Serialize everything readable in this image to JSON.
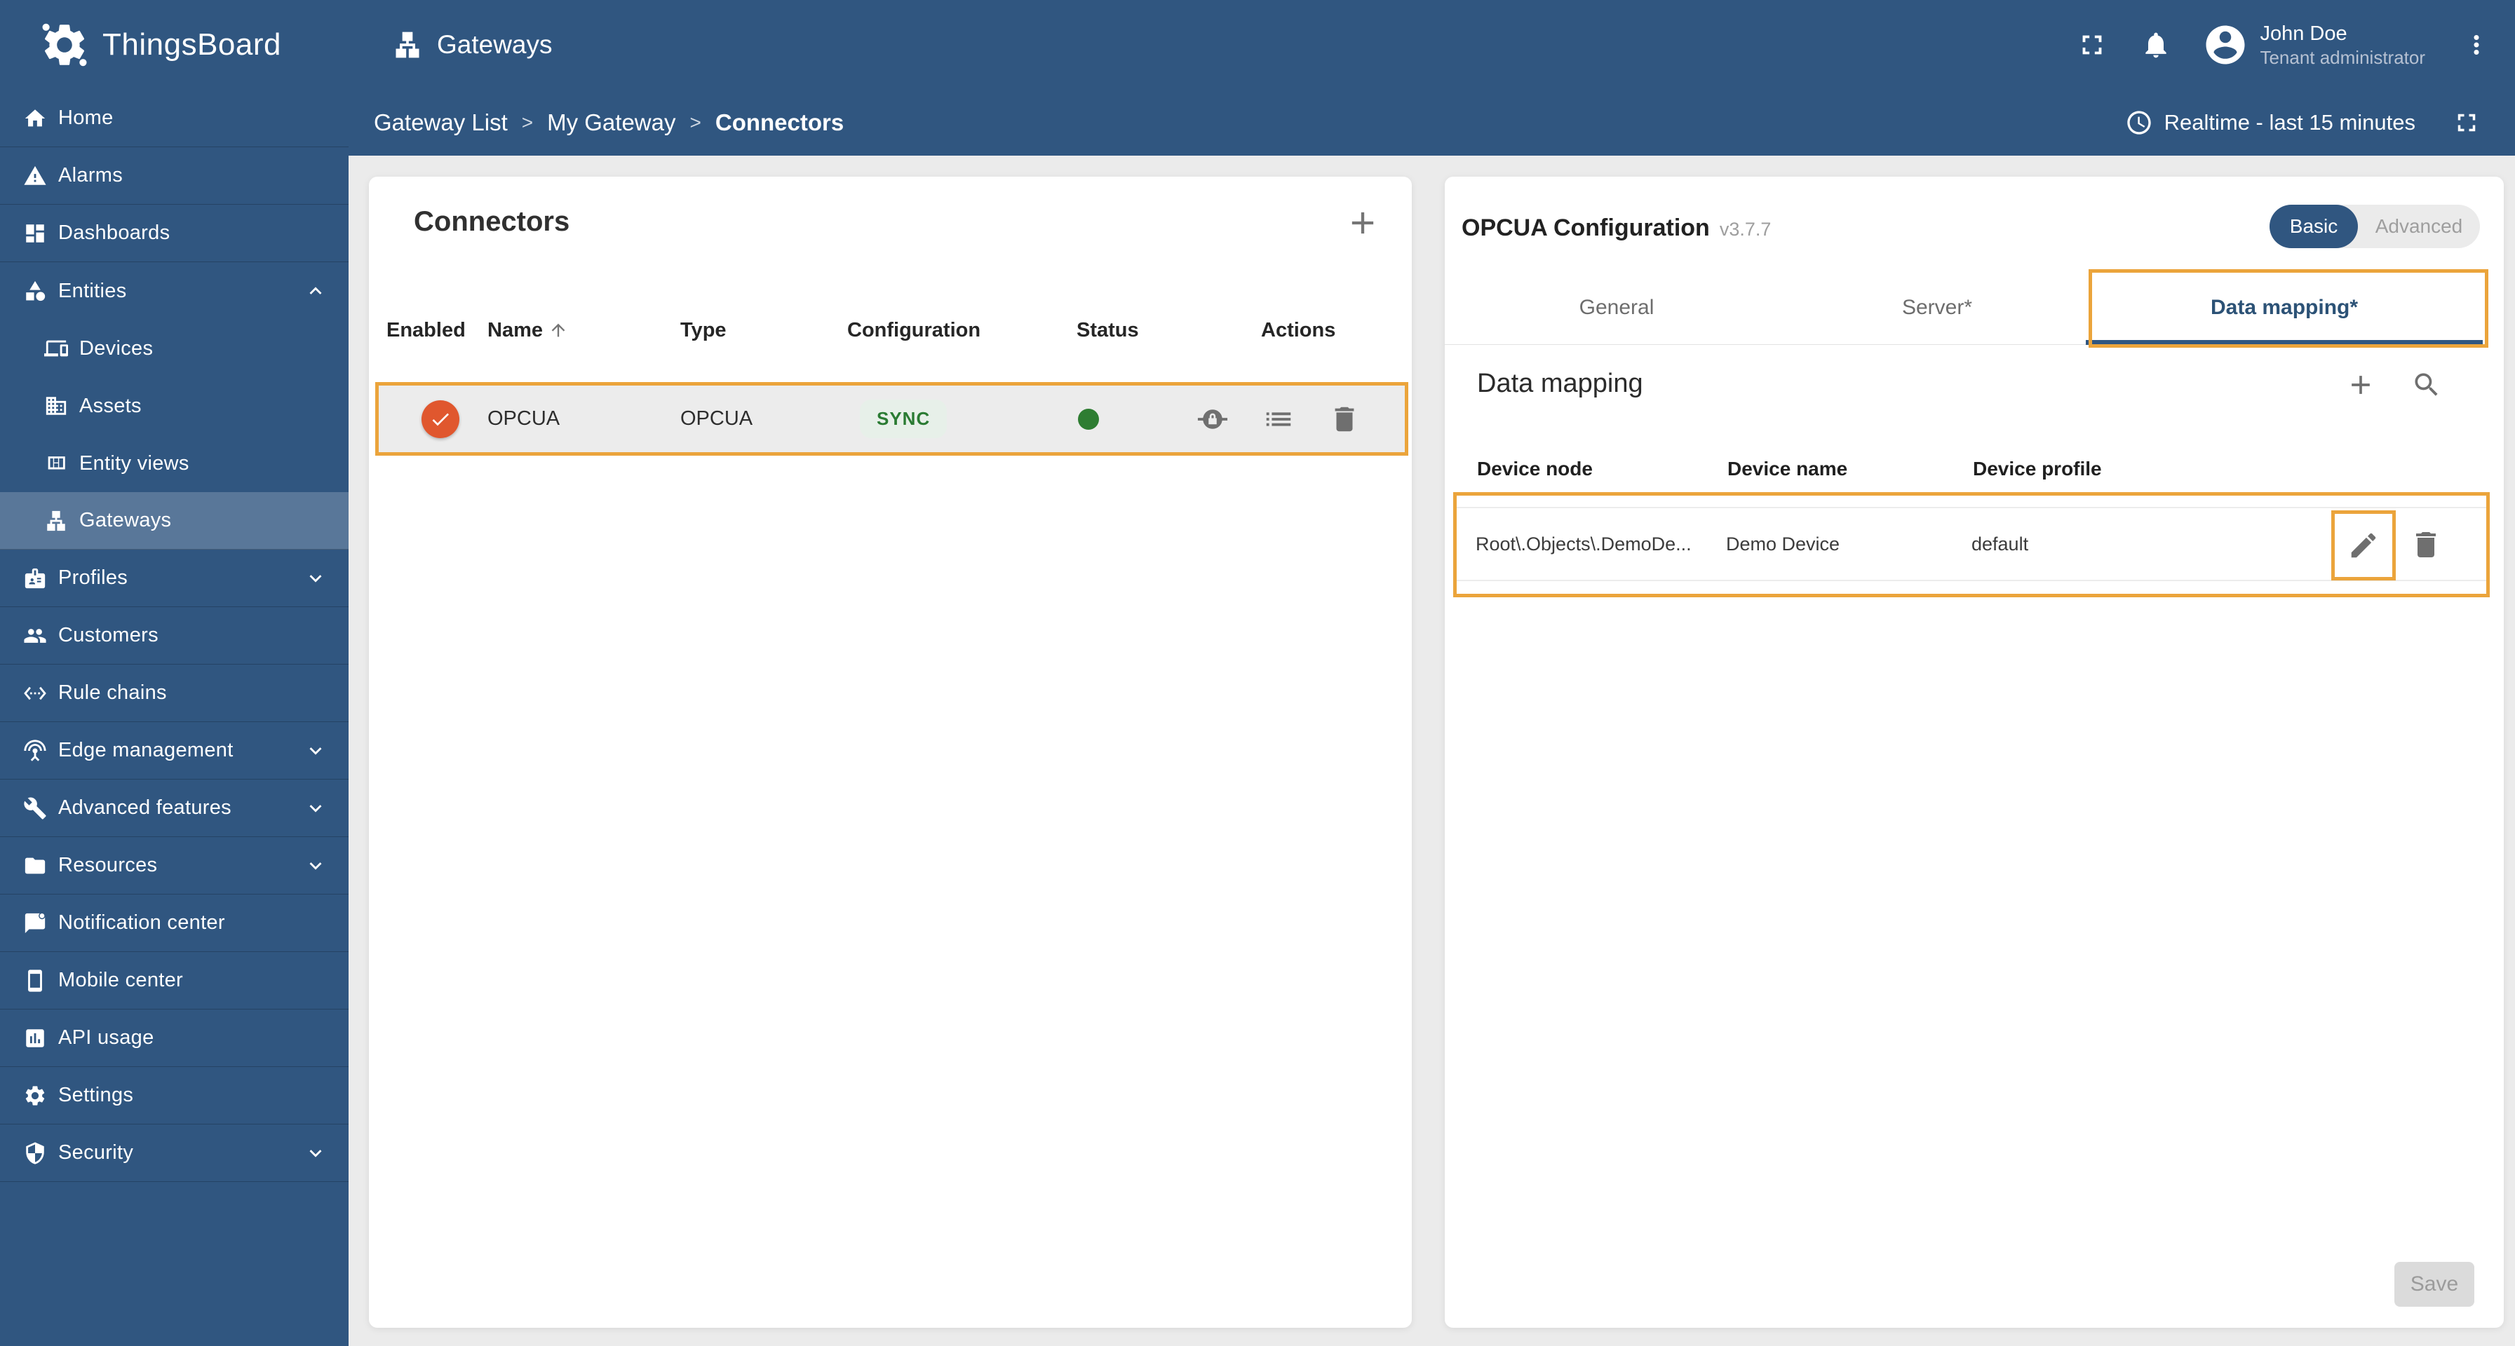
{
  "colors": {
    "primary": "#305680",
    "annotation": "#eba43b",
    "toggle_thumb": "#e0572e",
    "toggle_track": "#f0a189",
    "chip_bg": "#e7f0e9",
    "chip_text": "#2a7b33",
    "status_ok_green": "#2e7d32"
  },
  "topbar": {
    "brand": "ThingsBoard",
    "page_title": "Gateways",
    "user_name": "John Doe",
    "user_role": "Tenant administrator"
  },
  "breadcrumb": {
    "separator": ">",
    "items": [
      "Gateway List",
      "My Gateway",
      "Connectors"
    ]
  },
  "timewindow": "Realtime - last 15 minutes",
  "sidebar": {
    "items": [
      {
        "label": "Home"
      },
      {
        "label": "Alarms"
      },
      {
        "label": "Dashboards"
      },
      {
        "label": "Entities"
      },
      {
        "label": "Devices"
      },
      {
        "label": "Assets"
      },
      {
        "label": "Entity views"
      },
      {
        "label": "Gateways"
      },
      {
        "label": "Profiles"
      },
      {
        "label": "Customers"
      },
      {
        "label": "Rule chains"
      },
      {
        "label": "Edge management"
      },
      {
        "label": "Advanced features"
      },
      {
        "label": "Resources"
      },
      {
        "label": "Notification center"
      },
      {
        "label": "Mobile center"
      },
      {
        "label": "API usage"
      },
      {
        "label": "Settings"
      },
      {
        "label": "Security"
      }
    ]
  },
  "connectors": {
    "title": "Connectors",
    "columns": [
      "Enabled",
      "Name",
      "Type",
      "Configuration",
      "Status",
      "Actions"
    ],
    "row": {
      "enabled": true,
      "name": "OPCUA",
      "type": "OPCUA",
      "configuration": "SYNC"
    }
  },
  "config": {
    "title": "OPCUA Configuration",
    "version": "v3.7.7",
    "modes": [
      "Basic",
      "Advanced"
    ],
    "selected_mode": "Basic",
    "tabs": [
      "General",
      "Server*",
      "Data mapping*"
    ],
    "active_tab": "Data mapping*",
    "data_mapping": {
      "title": "Data mapping",
      "columns": [
        "Device node",
        "Device name",
        "Device profile"
      ],
      "row": {
        "device_node": "Root\\.Objects\\.DemoDe...",
        "device_name": "Demo Device",
        "device_profile": "default"
      }
    },
    "save_label": "Save"
  }
}
